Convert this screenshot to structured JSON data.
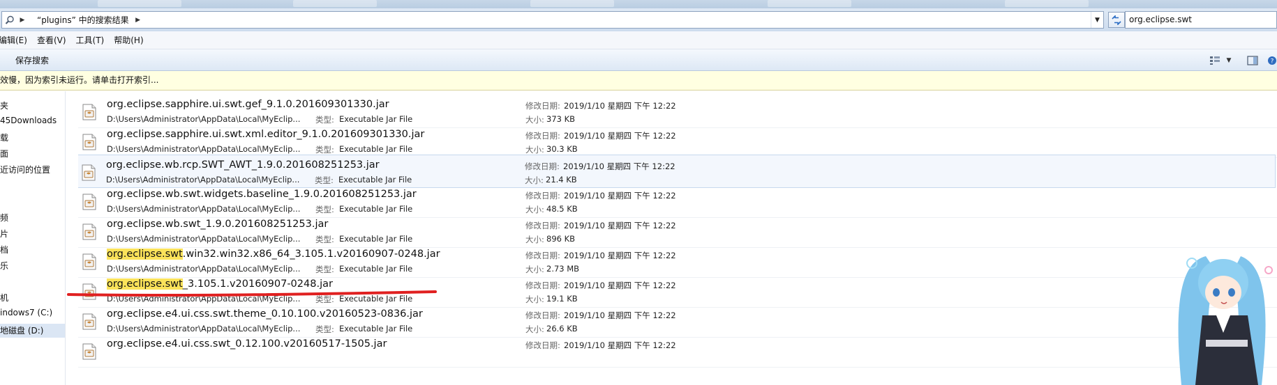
{
  "address": {
    "breadcrumb": "“plugins” 中的搜索结果",
    "search_value": "org.eclipse.swt"
  },
  "menu": {
    "items": [
      "编辑(E)",
      "查看(V)",
      "工具(T)",
      "帮助(H)"
    ]
  },
  "toolbar": {
    "save_search": "保存搜索"
  },
  "infobar": {
    "text": "效慢，因为索引未运行。请单击打开索引..."
  },
  "nav": {
    "items": [
      "夹",
      "45Downloads",
      "载",
      "面",
      "近访问的位置",
      "频",
      "片",
      "档",
      "乐",
      "机",
      "indows7 (C:)",
      "地磁盘 (D:)"
    ]
  },
  "labels": {
    "date": "修改日期:",
    "size": "大小:",
    "type": "类型:"
  },
  "results": [
    {
      "name": "org.eclipse.sapphire.ui.swt.gef_9.1.0.201609301330.jar",
      "match": "",
      "rest": "org.eclipse.sapphire.ui.swt.gef_9.1.0.201609301330.jar",
      "path": "D:\\Users\\Administrator\\AppData\\Local\\MyEclip...",
      "type": "Executable Jar File",
      "date": "2019/1/10 星期四 下午 12:22",
      "size": "373 KB"
    },
    {
      "name": "org.eclipse.sapphire.ui.swt.xml.editor_9.1.0.201609301330.jar",
      "match": "",
      "rest": "org.eclipse.sapphire.ui.swt.xml.editor_9.1.0.201609301330.jar",
      "path": "D:\\Users\\Administrator\\AppData\\Local\\MyEclip...",
      "type": "Executable Jar File",
      "date": "2019/1/10 星期四 下午 12:22",
      "size": "30.3 KB"
    },
    {
      "name": "org.eclipse.wb.rcp.SWT_AWT_1.9.0.201608251253.jar",
      "match": "",
      "rest": "org.eclipse.wb.rcp.SWT_AWT_1.9.0.201608251253.jar",
      "path": "D:\\Users\\Administrator\\AppData\\Local\\MyEclip...",
      "type": "Executable Jar File",
      "date": "2019/1/10 星期四 下午 12:22",
      "size": "21.4 KB"
    },
    {
      "name": "org.eclipse.wb.swt.widgets.baseline_1.9.0.201608251253.jar",
      "match": "",
      "rest": "org.eclipse.wb.swt.widgets.baseline_1.9.0.201608251253.jar",
      "path": "D:\\Users\\Administrator\\AppData\\Local\\MyEclip...",
      "type": "Executable Jar File",
      "date": "2019/1/10 星期四 下午 12:22",
      "size": "48.5 KB"
    },
    {
      "name": "org.eclipse.wb.swt_1.9.0.201608251253.jar",
      "match": "",
      "rest": "org.eclipse.wb.swt_1.9.0.201608251253.jar",
      "path": "D:\\Users\\Administrator\\AppData\\Local\\MyEclip...",
      "type": "Executable Jar File",
      "date": "2019/1/10 星期四 下午 12:22",
      "size": "896 KB"
    },
    {
      "name": "org.eclipse.swt.win32.win32.x86_64_3.105.1.v20160907-0248.jar",
      "match": "org.eclipse.swt",
      "rest": ".win32.win32.x86_64_3.105.1.v20160907-0248.jar",
      "path": "D:\\Users\\Administrator\\AppData\\Local\\MyEclip...",
      "type": "Executable Jar File",
      "date": "2019/1/10 星期四 下午 12:22",
      "size": "2.73 MB"
    },
    {
      "name": "org.eclipse.swt_3.105.1.v20160907-0248.jar",
      "match": "org.eclipse.swt",
      "rest": "_3.105.1.v20160907-0248.jar",
      "path": "D:\\Users\\Administrator\\AppData\\Local\\MyEclip...",
      "type": "Executable Jar File",
      "date": "2019/1/10 星期四 下午 12:22",
      "size": "19.1 KB"
    },
    {
      "name": "org.eclipse.e4.ui.css.swt.theme_0.10.100.v20160523-0836.jar",
      "match": "",
      "rest": "org.eclipse.e4.ui.css.swt.theme_0.10.100.v20160523-0836.jar",
      "path": "D:\\Users\\Administrator\\AppData\\Local\\MyEclip...",
      "type": "Executable Jar File",
      "date": "2019/1/10 星期四 下午 12:22",
      "size": "26.6 KB"
    },
    {
      "name": "org.eclipse.e4.ui.css.swt_0.12.100.v20160517-1505.jar",
      "match": "",
      "rest": "org.eclipse.e4.ui.css.swt_0.12.100.v20160517-1505.jar",
      "path": "",
      "type": "",
      "date": "2019/1/10 星期四 下午 12:22",
      "size": ""
    }
  ],
  "colors": {
    "highlight": "#fbe35a",
    "annotation": "#e02020",
    "infobar": "#ffffe1"
  }
}
